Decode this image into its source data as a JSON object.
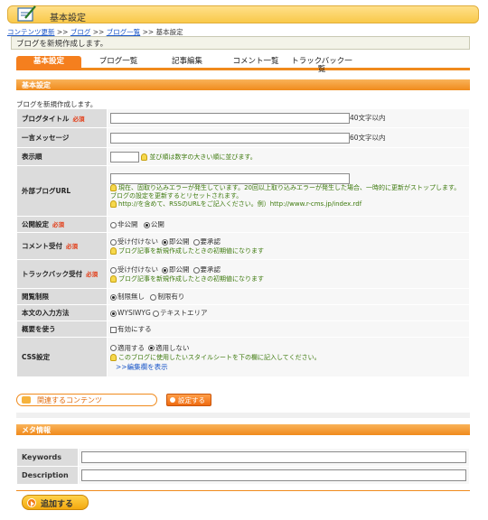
{
  "header": {
    "title": "基本設定"
  },
  "breadcrumb": {
    "items": [
      "コンテンツ更新",
      "ブログ",
      "ブログ一覧"
    ],
    "separator": ">>",
    "current": "基本設定"
  },
  "notice": "ブログを新規作成します。",
  "tabs": [
    "基本設定",
    "ブログ一覧",
    "記事編集",
    "コメント一覧",
    "トラックバック一覧"
  ],
  "section_basic": {
    "title": "基本設定",
    "intro": "ブログを新規作成します。"
  },
  "required_mark": "必須",
  "fields": {
    "blog_title": {
      "label": "ブログタイトル",
      "value": "",
      "suffix": "40文字以内"
    },
    "one_liner": {
      "label": "一言メッセージ",
      "value": "",
      "suffix": "60文字以内"
    },
    "display_order": {
      "label": "表示順",
      "value": "",
      "hint": "並び順は数字の大きい順に並びます。"
    },
    "external_url": {
      "label": "外部ブログURL",
      "value": "",
      "hint1": "現在、固取り込みエラーが発生しています。20回以上取り込みエラーが発生した場合、一時的に更新がストップします。ブログの設定を更新するとリセットされます。",
      "hint2": "http://を含めて、RSSのURLをご記入ください。例）http://www.r-cms.jp/index.rdf"
    },
    "publish": {
      "label": "公開設定",
      "options": [
        "非公開",
        "公開"
      ]
    },
    "comment": {
      "label": "コメント受付",
      "options": [
        "受け付けない",
        "即公開",
        "要承認"
      ],
      "hint": "ブログ記事を新規作成したときの初期値になります"
    },
    "trackback": {
      "label": "トラックバック受付",
      "options": [
        "受け付けない",
        "即公開",
        "要承認"
      ],
      "hint": "ブログ記事を新規作成したときの初期値になります"
    },
    "restriction": {
      "label": "閲覧制限",
      "options": [
        "制限無し",
        "制限有り"
      ]
    },
    "input_method": {
      "label": "本文の入力方法",
      "options": [
        "WYSIWYG",
        "テキストエリア"
      ]
    },
    "summary": {
      "label": "概要を使う",
      "option": "有効にする"
    },
    "css": {
      "label": "CSS設定",
      "options": [
        "適用する",
        "適用しない"
      ],
      "hint": "このブログに使用したいスタイルシートを下の欄に記入してください。",
      "link": ">>編集欄を表示"
    }
  },
  "buttons": {
    "related": "関連するコンテンツ",
    "set": "設定する",
    "add": "追加する"
  },
  "section_meta": {
    "title": "メタ情報",
    "keywords_label": "Keywords",
    "description_label": "Description",
    "keywords_value": "",
    "description_value": ""
  }
}
